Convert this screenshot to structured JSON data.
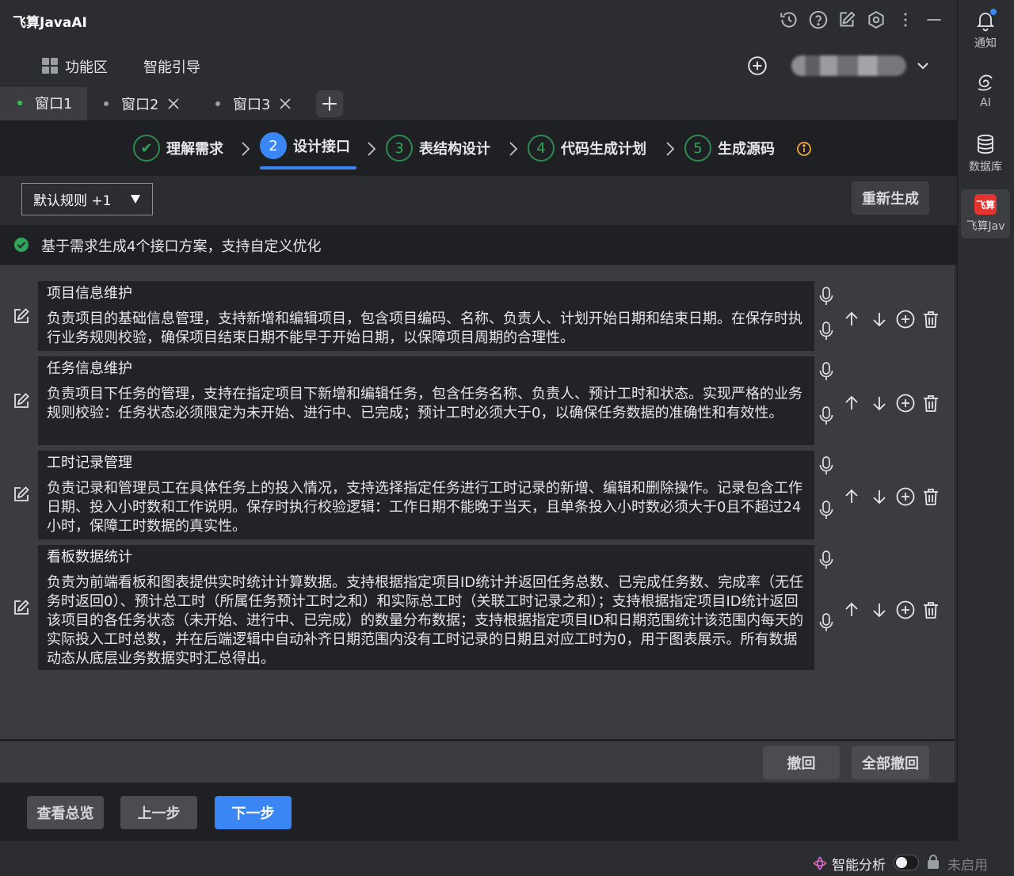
{
  "app": {
    "title": "飞算JavaAI"
  },
  "menu": {
    "func_label": "功能区",
    "guide_label": "智能引导"
  },
  "window_tabs": [
    {
      "label": "窗口1",
      "active": true
    },
    {
      "label": "窗口2",
      "active": false
    },
    {
      "label": "窗口3",
      "active": false
    }
  ],
  "steps": [
    {
      "num": "✔",
      "label": "理解需求",
      "state": "done"
    },
    {
      "num": "2",
      "label": "设计接口",
      "state": "active"
    },
    {
      "num": "3",
      "label": "表结构设计",
      "state": "pending"
    },
    {
      "num": "4",
      "label": "代码生成计划",
      "state": "pending"
    },
    {
      "num": "5",
      "label": "生成源码",
      "state": "pending"
    }
  ],
  "rules": {
    "selected": "默认规则 +1",
    "regenerate_label": "重新生成"
  },
  "status": {
    "text": "基于需求生成4个接口方案，支持自定义优化"
  },
  "interfaces": [
    {
      "title": "项目信息维护",
      "desc": "负责项目的基础信息管理，支持新增和编辑项目，包含项目编码、名称、负责人、计划开始日期和结束日期。在保存时执行业务规则校验，确保项目结束日期不能早于开始日期，以保障项目周期的合理性。"
    },
    {
      "title": "任务信息维护",
      "desc": "负责项目下任务的管理，支持在指定项目下新增和编辑任务，包含任务名称、负责人、预计工时和状态。实现严格的业务规则校验：任务状态必须限定为未开始、进行中、已完成；预计工时必须大于0，以确保任务数据的准确性和有效性。"
    },
    {
      "title": "工时记录管理",
      "desc": "负责记录和管理员工在具体任务上的投入情况，支持选择指定任务进行工时记录的新增、编辑和删除操作。记录包含工作日期、投入小时数和工作说明。保存时执行校验逻辑：工作日期不能晚于当天，且单条投入小时数必须大于0且不超过24小时，保障工时数据的真实性。"
    },
    {
      "title": "看板数据统计",
      "desc": "负责为前端看板和图表提供实时统计计算数据。支持根据指定项目ID统计并返回任务总数、已完成任务数、完成率（无任务时返回0）、预计总工时（所属任务预计工时之和）和实际总工时（关联工时记录之和）；支持根据指定项目ID统计返回该项目的各任务状态（未开始、进行中、已完成）的数量分布数据；支持根据指定项目ID和日期范围统计该范围内每天的实际投入工时总数，并在后端逻辑中自动补齐日期范围内没有工时记录的日期且对应工时为0，用于图表展示。所有数据动态从底层业务数据实时汇总得出。"
    }
  ],
  "actions": {
    "undo_label": "撤回",
    "undo_all_label": "全部撤回"
  },
  "footer": {
    "overview_label": "查看总览",
    "prev_label": "上一步",
    "next_label": "下一步"
  },
  "strip": {
    "ai_analysis_label": "智能分析",
    "disabled_label": "未启用"
  },
  "sidebar": [
    {
      "label": "通知",
      "icon": "bell-icon"
    },
    {
      "label": "AI",
      "icon": "ai-icon"
    },
    {
      "label": "数据库",
      "icon": "database-icon"
    },
    {
      "label": "飞算Jav",
      "icon": "feisuan-logo",
      "logo_text": "飞算"
    }
  ],
  "colors": {
    "accent": "#3a86f5",
    "success": "#2fa55a",
    "warning": "#f2a93b"
  }
}
